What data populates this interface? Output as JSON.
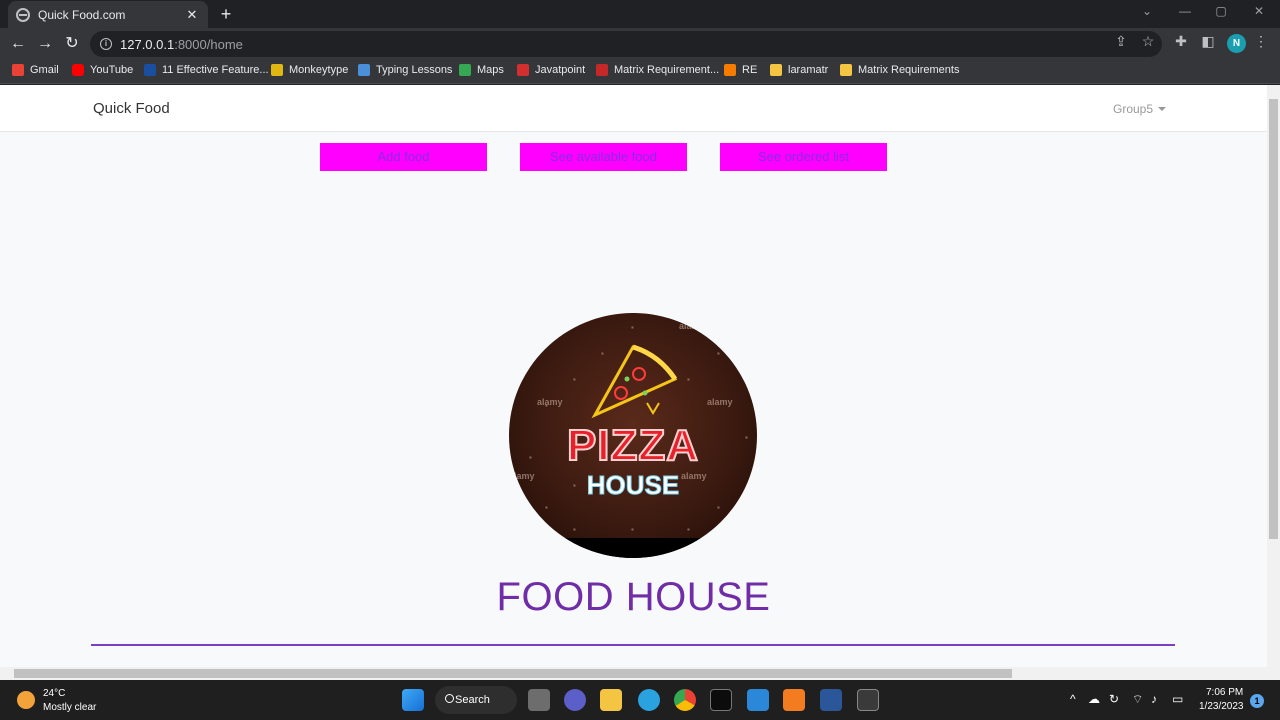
{
  "browser": {
    "tab_title": "Quick Food.com",
    "url_host": "127.0.0.1",
    "url_rest": ":8000/home",
    "bookmarks": [
      "Gmail",
      "YouTube",
      "11 Effective Feature...",
      "Monkeytype",
      "Typing Lessons",
      "Maps",
      "Javatpoint",
      "Matrix Requirement...",
      "RE",
      "laramatr",
      "Matrix Requirements"
    ],
    "profile_initial": "N"
  },
  "navbar": {
    "brand": "Quick Food",
    "user_menu": "Group5"
  },
  "actions": {
    "add_food": "Add food",
    "see_available": "See available food",
    "see_ordered": "See ordered list"
  },
  "logo": {
    "word1": "PIZZA",
    "word2": "HOUSE",
    "watermark": "alamy"
  },
  "headline": "FOOD HOUSE",
  "taskbar": {
    "temperature": "24°C",
    "weather": "Mostly clear",
    "search": "Search",
    "time": "7:06 PM",
    "date": "1/23/2023",
    "notifications": "1"
  },
  "colors": {
    "button_bg": "#ff00ff",
    "button_text": "#8a2be2",
    "headline": "#6f2da8",
    "rule": "#7b3fc4"
  }
}
